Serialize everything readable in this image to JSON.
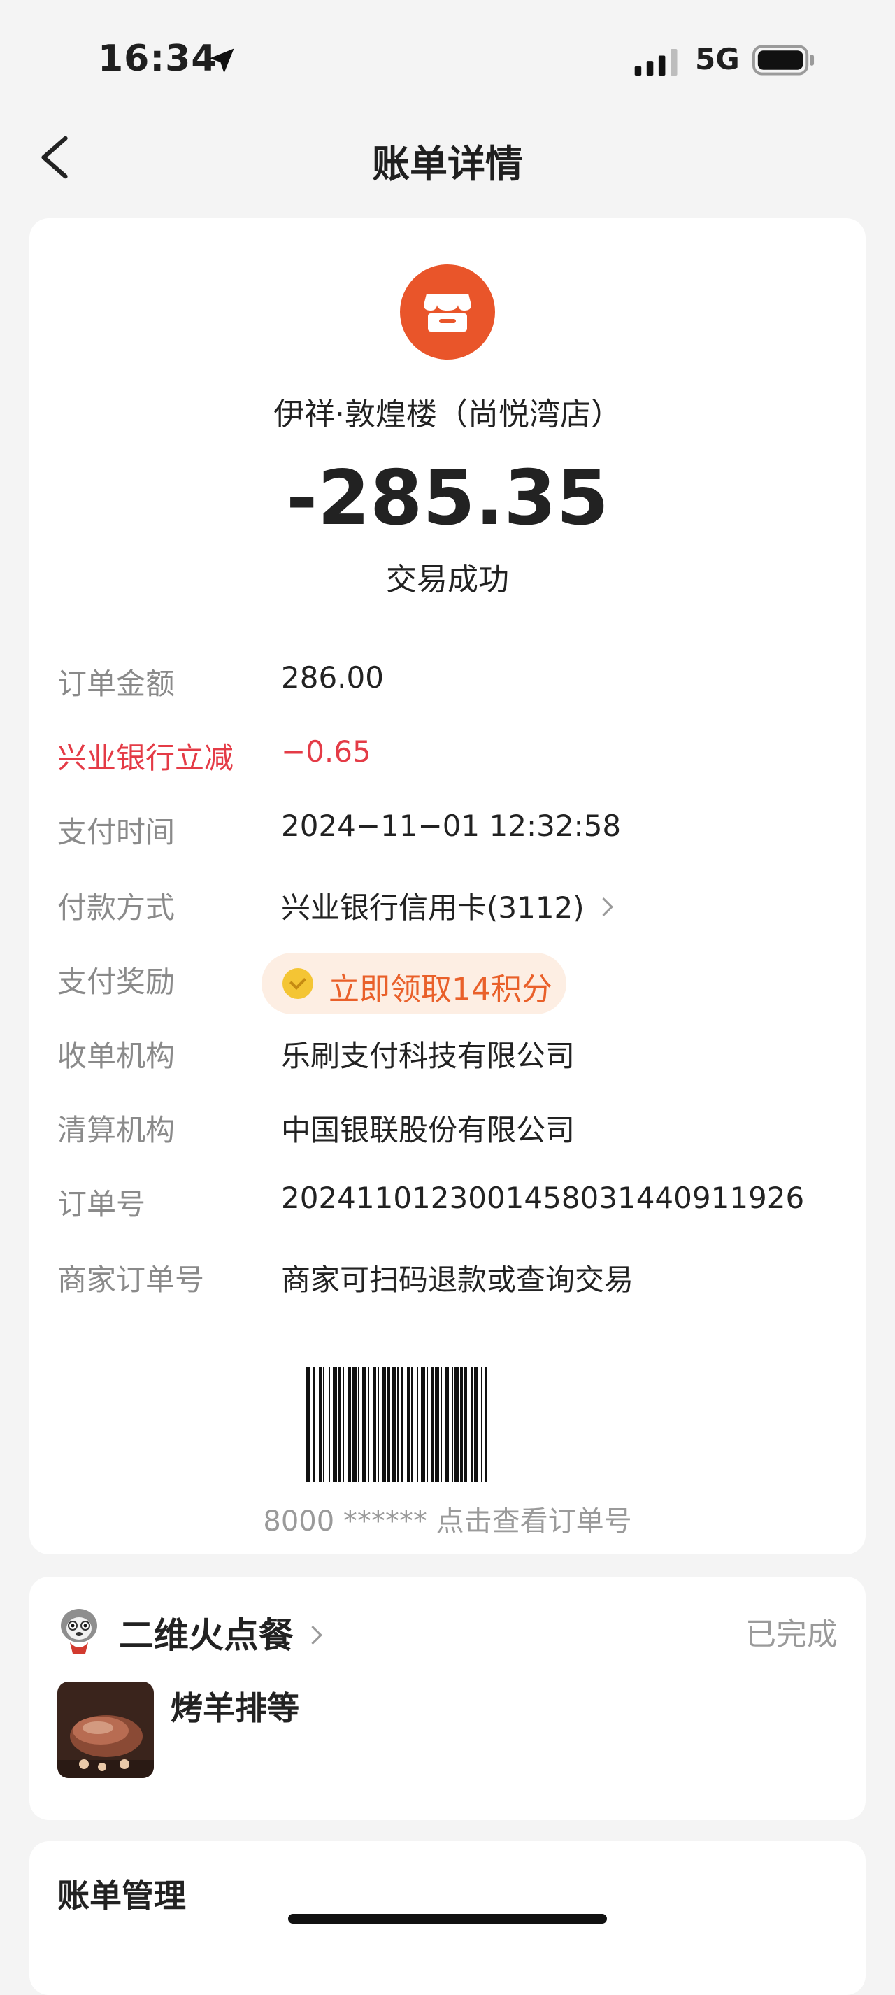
{
  "status_bar": {
    "time": "16:34",
    "network": "5G",
    "icons": [
      "location-arrow-icon",
      "signal-bars-icon",
      "battery-icon"
    ]
  },
  "nav": {
    "title": "账单详情",
    "back_icon": "chevron-left-icon"
  },
  "bill": {
    "merchant": "伊祥·敦煌楼（尚悦湾店）",
    "amount": "-285.35",
    "status": "交易成功",
    "store_icon": "storefront-icon",
    "brand_color": "#e9552a",
    "accent_red": "#e43b46",
    "accent_orange": "#e9602a",
    "rows": [
      {
        "label": "订单金额",
        "value": "286.00"
      },
      {
        "label": "兴业银行立减",
        "value": "−0.65"
      },
      {
        "label": "支付时间",
        "value": "2024−11−01 12:32:58"
      },
      {
        "label": "付款方式",
        "value": "兴业银行信用卡(3112)"
      },
      {
        "label": "支付奖励",
        "value": "立即领取14积分"
      },
      {
        "label": "收单机构",
        "value": "乐刷支付科技有限公司"
      },
      {
        "label": "清算机构",
        "value": "中国银联股份有限公司"
      },
      {
        "label": "订单号",
        "value": "2024110123001458031440911926"
      },
      {
        "label": "商家订单号",
        "value": "商家可扫码退款或查询交易"
      }
    ],
    "barcode_text": "8000 ****** 点击查看订单号"
  },
  "mini_app": {
    "name": "二维火点餐",
    "status": "已完成",
    "item": "烤羊排等"
  },
  "management": {
    "title": "账单管理"
  }
}
